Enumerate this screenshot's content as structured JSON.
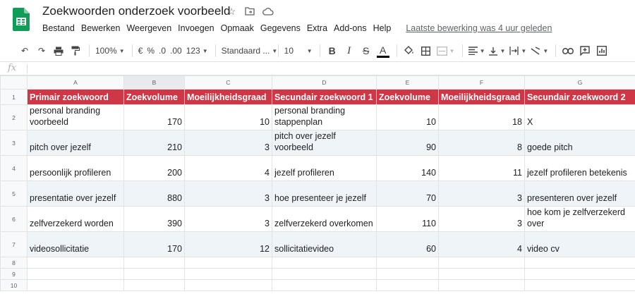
{
  "doc": {
    "title": "Zoekwoorden onderzoek voorbeeld",
    "menu": [
      "Bestand",
      "Bewerken",
      "Weergeven",
      "Invoegen",
      "Opmaak",
      "Gegevens",
      "Extra",
      "Add-ons",
      "Help"
    ],
    "last_edit": "Laatste bewerking was 4 uur geleden"
  },
  "toolbar": {
    "zoom": "100%",
    "currency": "€",
    "percent": "%",
    "dec_decrease": ".0",
    "dec_increase": ".00",
    "format_more": "123",
    "font": "Standaard ...",
    "font_size": "10",
    "bold": "B",
    "italic": "I",
    "strike": "S",
    "text_color": "A"
  },
  "formula": {
    "fx": "fx",
    "value": ""
  },
  "colors": {
    "header_fill": "#cf3747",
    "header_text": "#ffffff",
    "alt_row": "#eef4f8",
    "app_green": "#0f9d58"
  },
  "sheet": {
    "columns": [
      "A",
      "B",
      "C",
      "D",
      "E",
      "F",
      "G"
    ],
    "row_numbers": [
      "1",
      "2",
      "3",
      "4",
      "5",
      "6",
      "7",
      "8",
      "9",
      "10"
    ],
    "headers": [
      "Primair zoekwoord",
      "Zoekvolume",
      "Moeilijkheidsgraad",
      "Secundair zoekwoord 1",
      "Zoekvolume",
      "Moeilijkheidsgraad",
      "Secundair zoekwoord 2"
    ],
    "rows": [
      [
        "personal branding voorbeeld",
        "170",
        "10",
        "personal branding stappenplan",
        "10",
        "18",
        "X"
      ],
      [
        "pitch over jezelf",
        "210",
        "3",
        "pitch over jezelf voorbeeld",
        "90",
        "8",
        "goede pitch"
      ],
      [
        "persoonlijk profileren",
        "200",
        "4",
        "jezelf profileren",
        "140",
        "11",
        "jezelf profileren betekenis"
      ],
      [
        "presentatie over jezelf",
        "880",
        "3",
        "hoe presenteer je jezelf",
        "70",
        "3",
        "presenteren over jezelf"
      ],
      [
        "zelfverzekerd worden",
        "390",
        "3",
        "zelfverzekerd overkomen",
        "110",
        "3",
        "hoe kom je zelfverzekerd over"
      ],
      [
        "videosollicitatie",
        "170",
        "12",
        "sollicitatievideo",
        "60",
        "4",
        "video cv"
      ]
    ]
  }
}
